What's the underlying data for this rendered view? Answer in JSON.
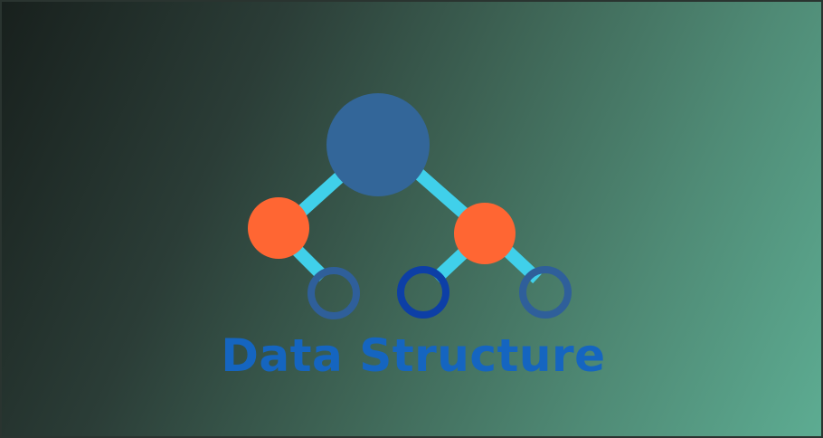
{
  "banner": {
    "title": "Data Structure"
  },
  "logo": {
    "icon": "binary-tree-icon",
    "colors": {
      "edges": "#40d0ea",
      "root_node": "#336699",
      "mid_nodes": "#ff6633",
      "leaf_ring": "#2f5f9a",
      "leaf_ring_dark": "#0d3fa6",
      "title_text": "#1565c0"
    }
  }
}
